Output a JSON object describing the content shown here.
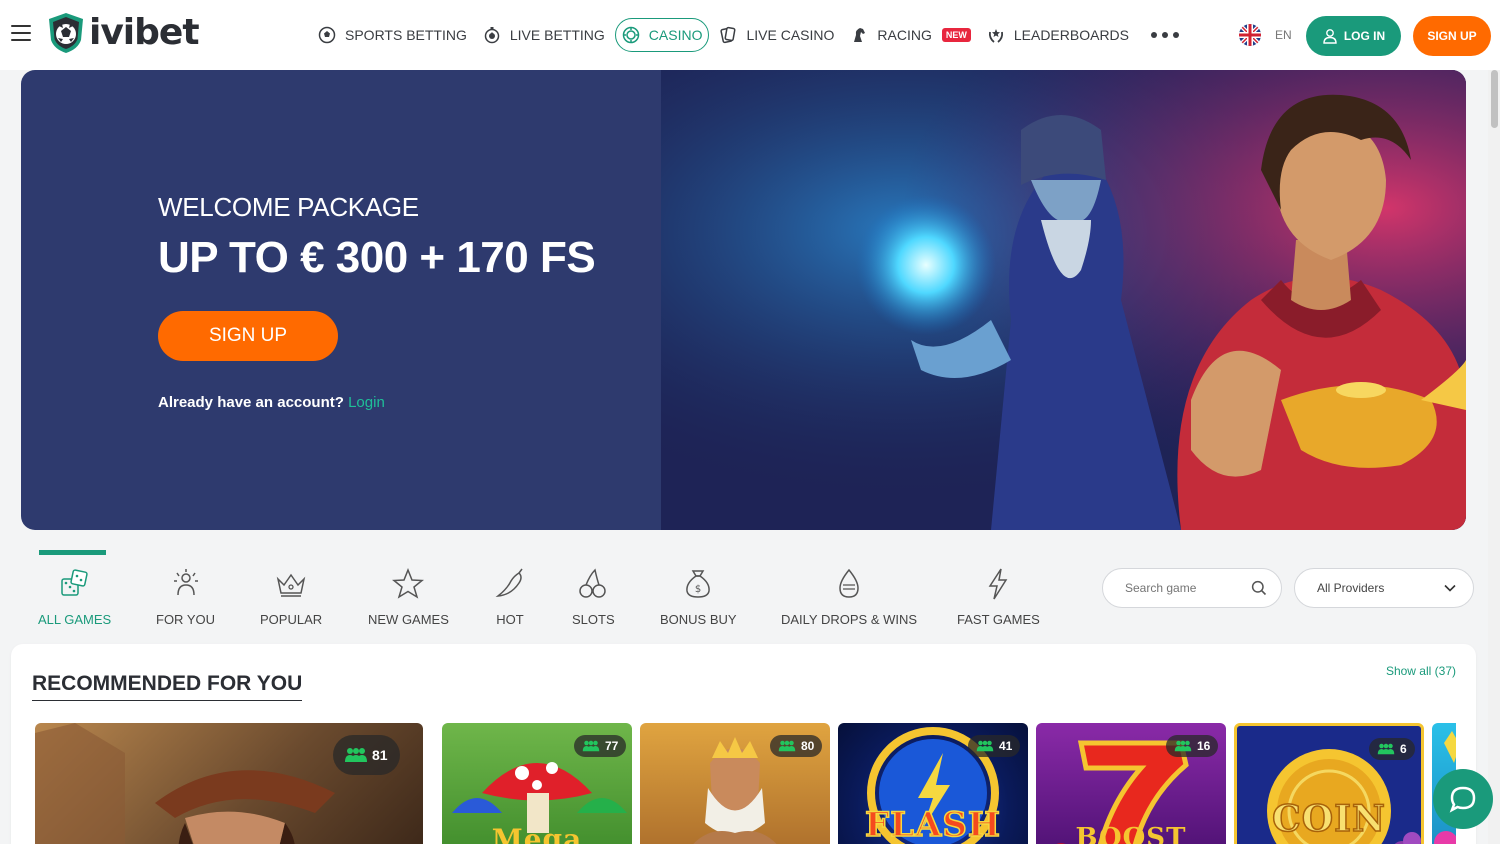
{
  "brand": {
    "name": "ivibet",
    "accent": "#1a9a7b",
    "cta": "#ff6a00"
  },
  "nav": {
    "items": [
      {
        "label": "SPORTS BETTING",
        "icon": "soccer-ball-icon"
      },
      {
        "label": "LIVE BETTING",
        "icon": "stopwatch-icon"
      },
      {
        "label": "CASINO",
        "icon": "casino-chip-icon",
        "active": true
      },
      {
        "label": "LIVE CASINO",
        "icon": "cards-icon"
      },
      {
        "label": "RACING",
        "icon": "horse-icon",
        "badge": "NEW"
      },
      {
        "label": "LEADERBOARDS",
        "icon": "laurel-icon"
      }
    ]
  },
  "header": {
    "lang": "EN",
    "login": "LOG IN",
    "signup": "SIGN UP"
  },
  "hero": {
    "kicker": "WELCOME PACKAGE",
    "title": "UP TO € 300 + 170 FS",
    "cta": "SIGN UP",
    "account_text": "Already have an account?",
    "login_link": "Login"
  },
  "categories": [
    {
      "label": "ALL GAMES",
      "icon": "dice-icon",
      "active": true
    },
    {
      "label": "FOR YOU",
      "icon": "party-person-icon"
    },
    {
      "label": "POPULAR",
      "icon": "crown-icon"
    },
    {
      "label": "NEW GAMES",
      "icon": "star-icon"
    },
    {
      "label": "HOT",
      "icon": "chili-icon"
    },
    {
      "label": "SLOTS",
      "icon": "cherries-icon"
    },
    {
      "label": "BONUS BUY",
      "icon": "money-bag-icon"
    },
    {
      "label": "DAILY DROPS & WINS",
      "icon": "drops-wins-icon"
    },
    {
      "label": "FAST GAMES",
      "icon": "lightning-icon"
    }
  ],
  "search": {
    "placeholder": "Search game"
  },
  "providers": {
    "selected": "All Providers"
  },
  "recommended": {
    "title": "RECOMMENDED FOR YOU",
    "show_all": "Show all",
    "count": "(37)",
    "games": [
      {
        "players": "81"
      },
      {
        "players": "77",
        "word": "Mega"
      },
      {
        "players": "80"
      },
      {
        "players": "41",
        "word": "FLASH"
      },
      {
        "players": "16",
        "word": "BOOST"
      },
      {
        "players": "6",
        "word": "COIN"
      }
    ]
  }
}
